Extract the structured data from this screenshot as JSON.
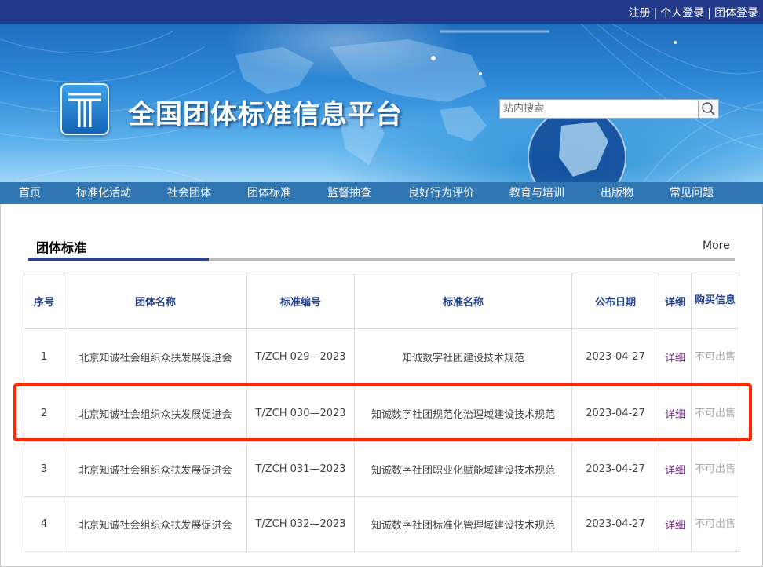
{
  "header": {
    "links": [
      "注册",
      "个人登录",
      "团体登录"
    ],
    "separator": "|"
  },
  "banner": {
    "site_title": "全国团体标准信息平台",
    "search_placeholder": "站内搜索"
  },
  "nav": {
    "items": [
      "首页",
      "标准化活动",
      "社会团体",
      "团体标准",
      "监督抽查",
      "良好行为评价",
      "教育与培训",
      "出版物",
      "常见问题"
    ]
  },
  "section": {
    "title": "团体标准",
    "more": "More"
  },
  "table": {
    "headers": [
      "序号",
      "团体名称",
      "标准编号",
      "标准名称",
      "公布日期",
      "详细",
      "购买信息"
    ],
    "rows": [
      {
        "no": "1",
        "org": "北京知诚社会组织众扶发展促进会",
        "code": "T/ZCH 029—2023",
        "name": "知诚数字社团建设技术规范",
        "date": "2023-04-27",
        "detail": "详细",
        "buy": "不可出售"
      },
      {
        "no": "2",
        "org": "北京知诚社会组织众扶发展促进会",
        "code": "T/ZCH 030—2023",
        "name": "知诚数字社团规范化治理域建设技术规范",
        "date": "2023-04-27",
        "detail": "详细",
        "buy": "不可出售"
      },
      {
        "no": "3",
        "org": "北京知诚社会组织众扶发展促进会",
        "code": "T/ZCH 031—2023",
        "name": "知诚数字社团职业化赋能域建设技术规范",
        "date": "2023-04-27",
        "detail": "详细",
        "buy": "不可出售"
      },
      {
        "no": "4",
        "org": "北京知诚社会组织众扶发展促进会",
        "code": "T/ZCH 032—2023",
        "name": "知诚数字社团标准化管理域建设技术规范",
        "date": "2023-04-27",
        "detail": "详细",
        "buy": "不可出售"
      }
    ],
    "highlighted_row": "2"
  },
  "colors": {
    "topbar": "#243b8c",
    "nav": "#2f76b2",
    "header_text": "#23418a",
    "link": "#7a2a8c",
    "highlight": "#ff2a00"
  }
}
